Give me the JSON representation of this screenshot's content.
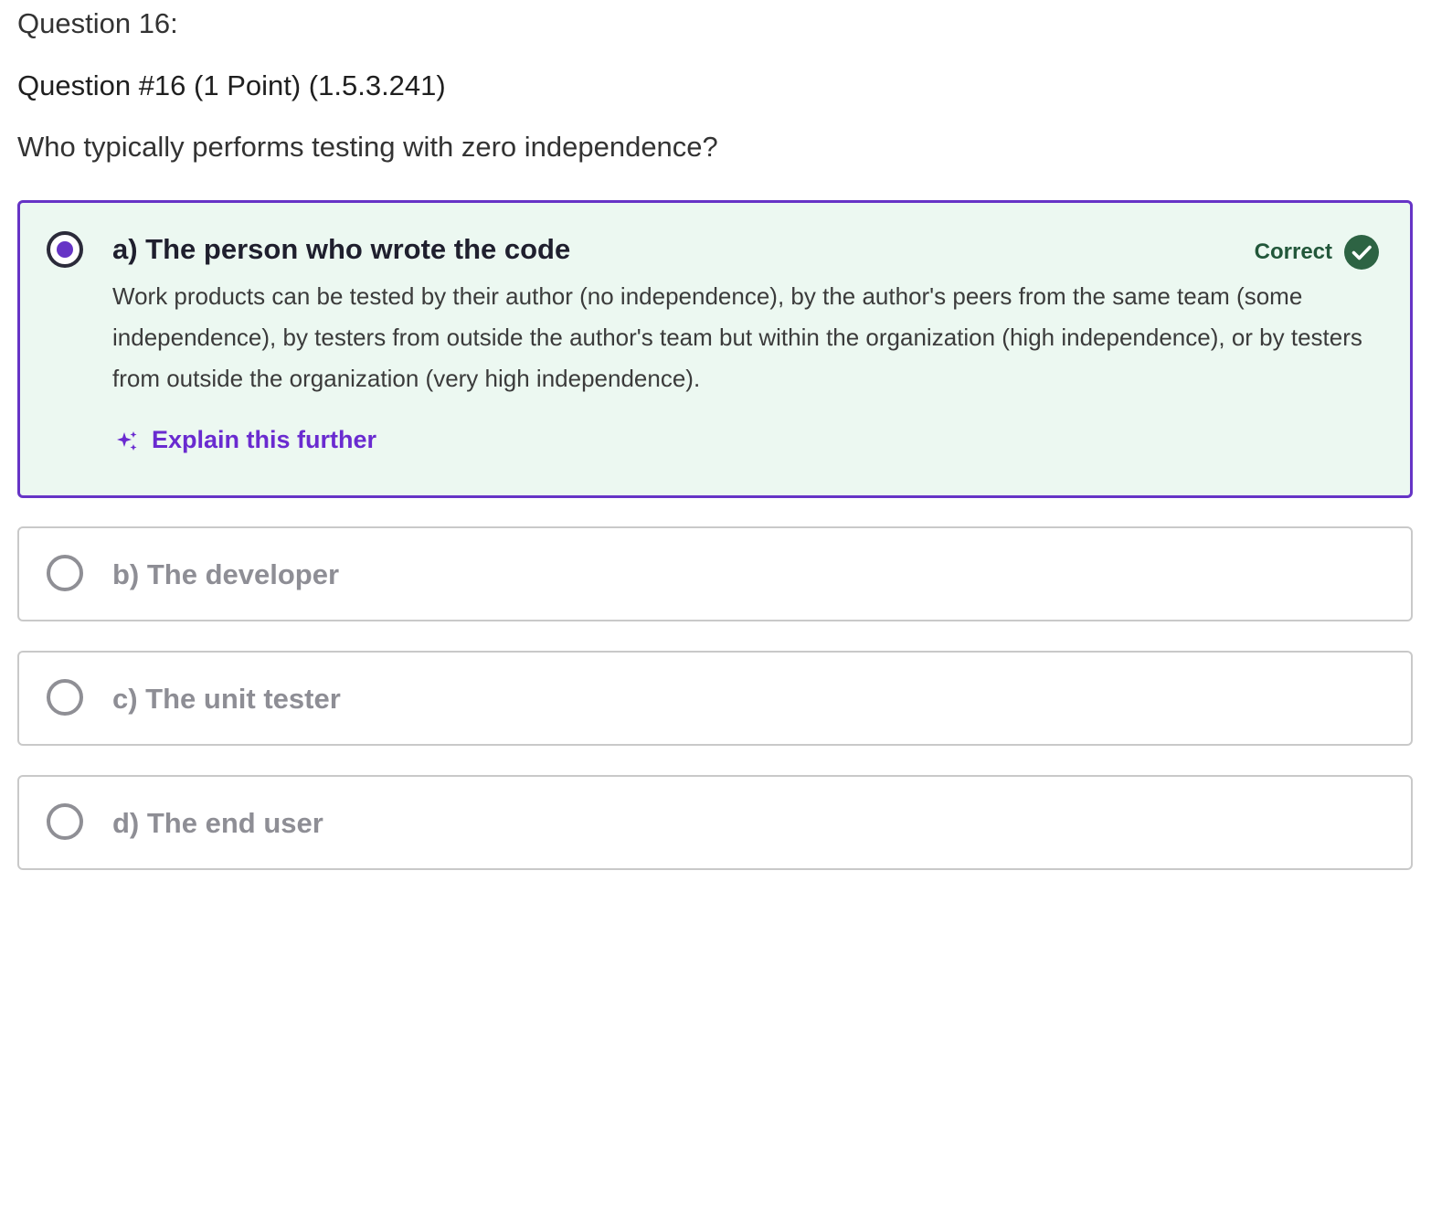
{
  "question": {
    "number_label": "Question 16:",
    "meta": "Question #16 (1 Point) (1.5.3.241)",
    "prompt": "Who typically performs testing with zero independence?"
  },
  "options": [
    {
      "label": "a) The person who wrote the code",
      "selected": true,
      "status": "Correct",
      "status_icon": "check-circle-icon",
      "feedback": "Work products can be tested by their author (no independence), by the author's peers from the same team (some independence), by testers from outside the author's team but within the organization (high independence), or by testers from outside the organization (very high independence).",
      "explain_link": "Explain this further",
      "explain_icon": "sparkle-icon"
    },
    {
      "label": "b) The developer",
      "selected": false
    },
    {
      "label": "c) The unit tester",
      "selected": false
    },
    {
      "label": "d) The end user",
      "selected": false
    }
  ],
  "colors": {
    "accent_purple": "#6634c6",
    "correct_green": "#2d6343",
    "selected_background": "#ecf8f1",
    "unselected_border": "#c9c9c9",
    "muted_text": "#8e8e95"
  }
}
